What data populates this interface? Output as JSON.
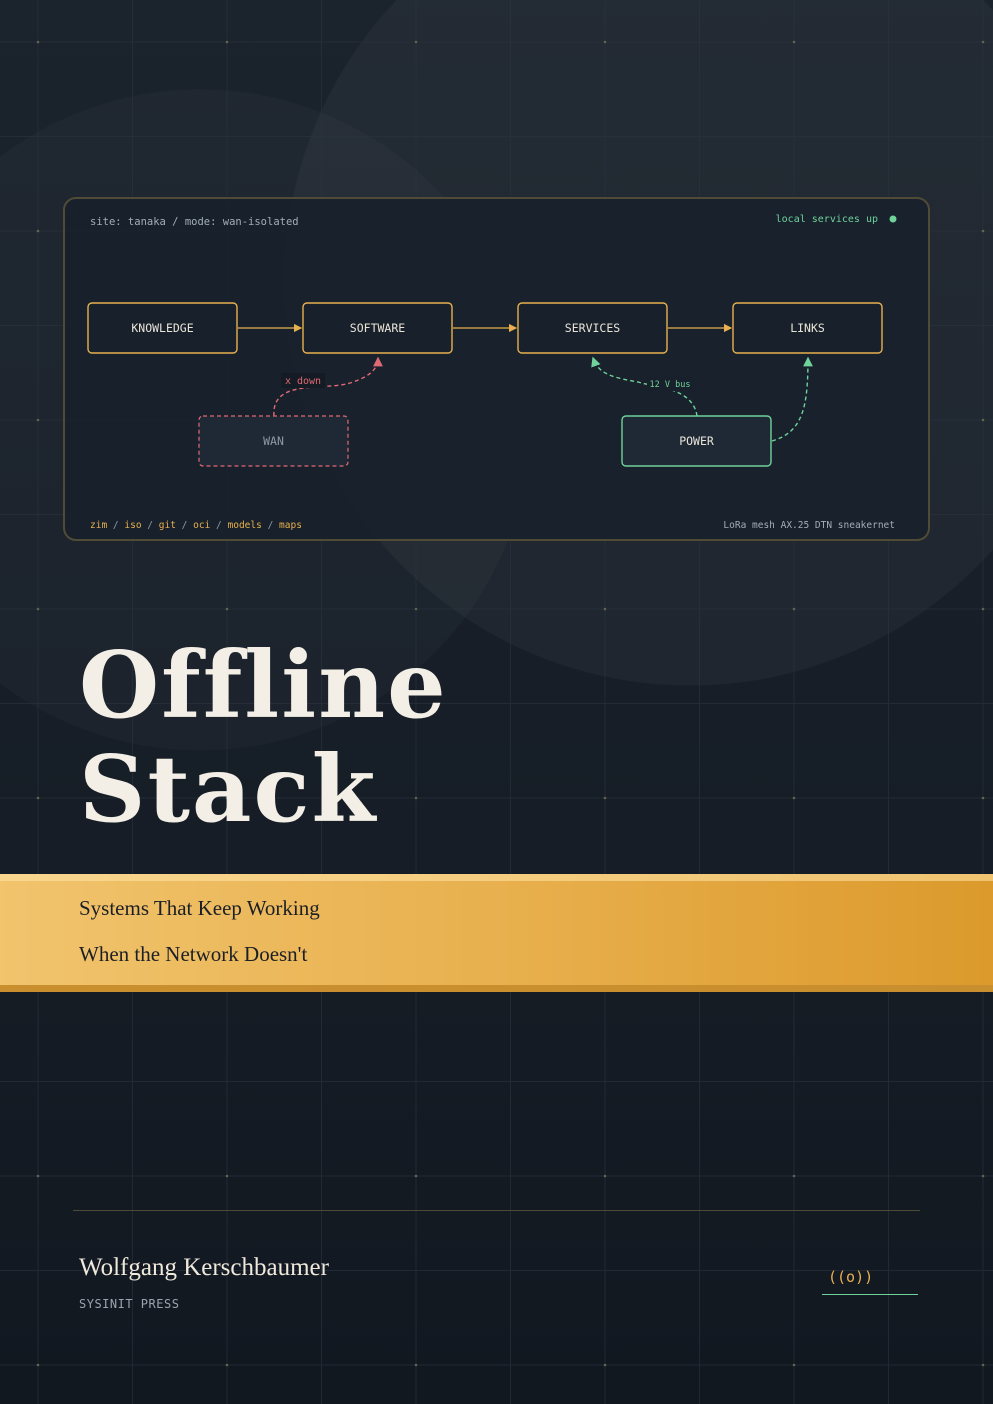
{
  "diagram": {
    "site_label": "site: tanaka / mode: wan-isolated",
    "status_label": "local services up",
    "nodes": {
      "knowledge": "KNOWLEDGE",
      "software": "SOFTWARE",
      "services": "SERVICES",
      "links": "LINKS",
      "wan": "WAN",
      "power": "POWER"
    },
    "wan_edge_label": "x down",
    "power_edge_label": "12 V bus",
    "formats": [
      "zim",
      "iso",
      "git",
      "oci",
      "models",
      "maps"
    ],
    "formats_separator": "/",
    "link_types": "LoRa mesh AX.25 DTN sneakernet"
  },
  "title": {
    "line1": "Offline",
    "line2": "Stack"
  },
  "subtitle": {
    "line1": "Systems That Keep Working",
    "line2": "When the Network Doesn't"
  },
  "author": "Wolfgang Kerschbaumer",
  "publisher": "SYSINIT PRESS",
  "logo_mark": "((o))",
  "colors": {
    "background": "#161d26",
    "accent_gold": "#e8b04e",
    "accent_green": "#6fd39a",
    "alert_red": "#e06a74",
    "title_text": "#f3efe6"
  }
}
